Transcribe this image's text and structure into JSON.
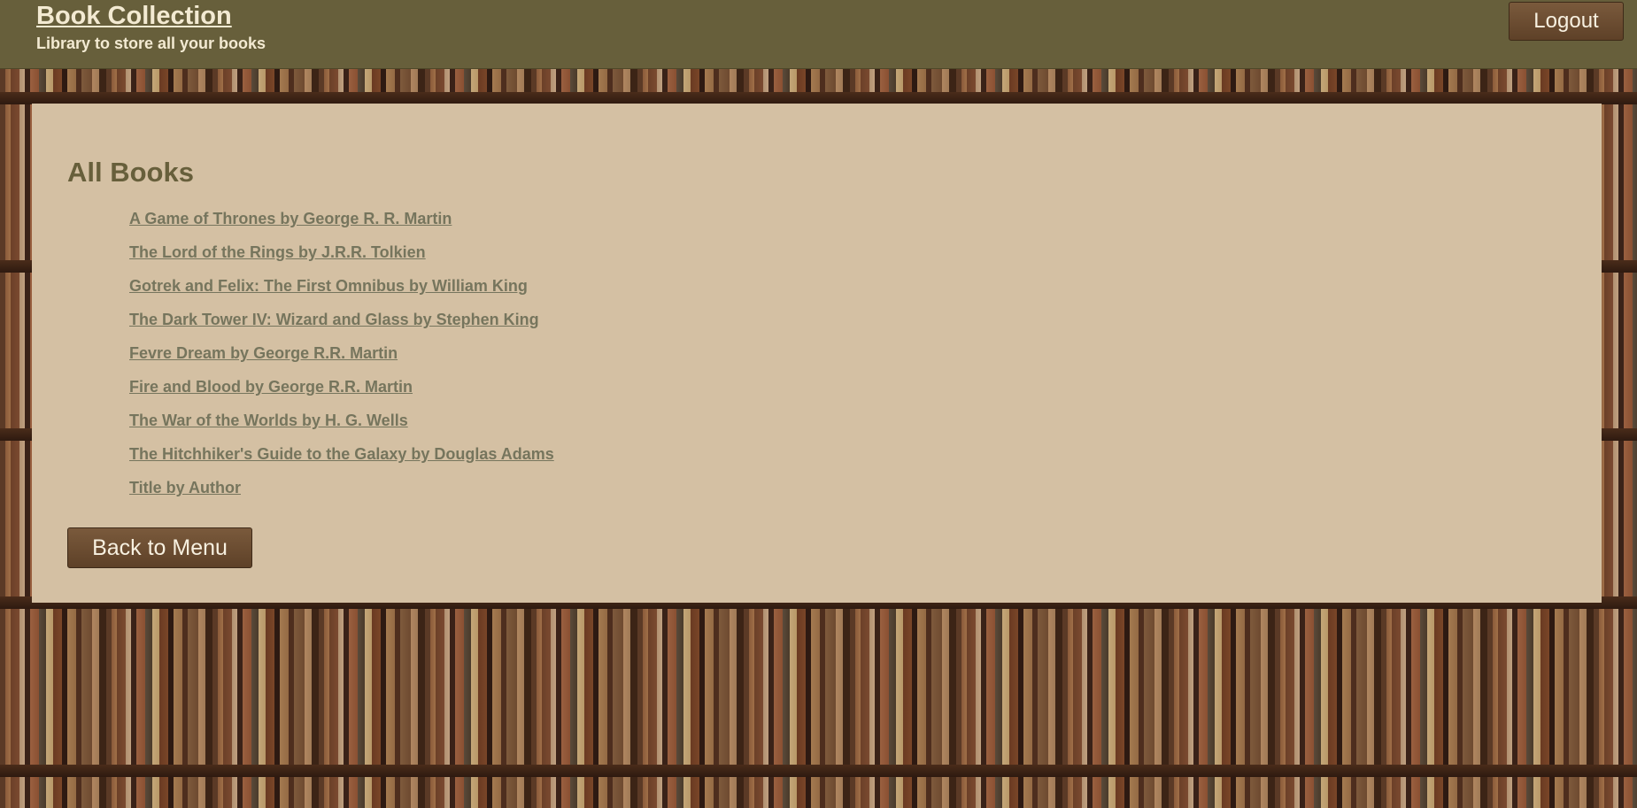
{
  "header": {
    "title": "Book Collection",
    "subtitle": "Library to store all your books",
    "logout_label": "Logout"
  },
  "main": {
    "heading": "All Books",
    "books": [
      "A Game of Thrones by George R. R. Martin",
      "The Lord of the Rings by J.R.R. Tolkien",
      "Gotrek and Felix: The First Omnibus by William King",
      "The Dark Tower IV: Wizard and Glass by Stephen King",
      "Fevre Dream by George R.R. Martin",
      "Fire and Blood by George R.R. Martin",
      "The War of the Worlds by H. G. Wells",
      "The Hitchhiker's Guide to the Galaxy by Douglas Adams",
      "Title by Author"
    ],
    "back_label": "Back to Menu"
  },
  "colors": {
    "header_bg": "#675f3b",
    "panel_bg": "#d4c0a3",
    "heading": "#675f3b",
    "link": "#76755d",
    "button_bg": "#6b4c30"
  }
}
